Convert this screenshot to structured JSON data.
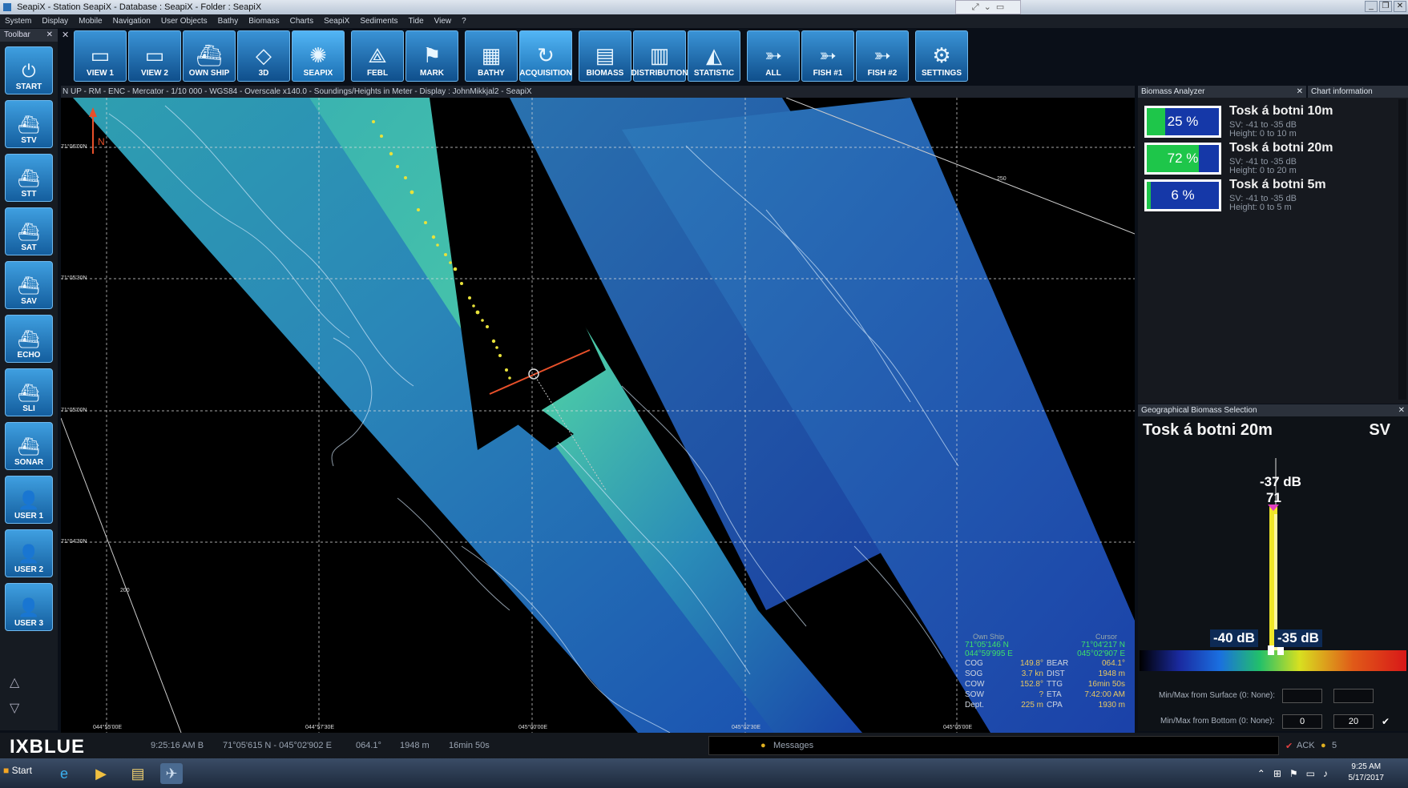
{
  "window": {
    "title": "SeapiX - Station SeapiX - Database : SeapiX - Folder : SeapiX"
  },
  "menu": [
    "System",
    "Display",
    "Mobile",
    "Navigation",
    "User Objects",
    "Bathy",
    "Biomass",
    "Charts",
    "SeapiX",
    "Sediments",
    "Tide",
    "View",
    "?"
  ],
  "toolbar_label": "Toolbar",
  "left_tools": [
    {
      "label": "START",
      "icon": "power-icon"
    },
    {
      "label": "STV",
      "icon": "ship-icon"
    },
    {
      "label": "STT",
      "icon": "ship-icon"
    },
    {
      "label": "SAT",
      "icon": "ship-icon"
    },
    {
      "label": "SAV",
      "icon": "ship-icon"
    },
    {
      "label": "ECHO",
      "icon": "ship-icon"
    },
    {
      "label": "SLI",
      "icon": "ship-icon"
    },
    {
      "label": "SONAR",
      "icon": "ship-icon"
    },
    {
      "label": "USER 1",
      "icon": "user-icon"
    },
    {
      "label": "USER 2",
      "icon": "user-icon"
    },
    {
      "label": "USER 3",
      "icon": "user-icon"
    }
  ],
  "top_tools": [
    {
      "label": "VIEW 1",
      "icon": "monitor-icon"
    },
    {
      "label": "VIEW 2",
      "icon": "monitor-icon"
    },
    {
      "label": "OWN SHIP",
      "icon": "ship-icon"
    },
    {
      "label": "3D",
      "icon": "3d-icon"
    },
    {
      "label": "SEAPIX",
      "icon": "seapix-icon"
    },
    {
      "label": "FEBL",
      "icon": "compass-icon"
    },
    {
      "label": "MARK",
      "icon": "flag-icon"
    },
    {
      "label": "BATHY",
      "icon": "bathy-icon"
    },
    {
      "label": "ACQUISITION",
      "icon": "refresh-icon"
    },
    {
      "label": "BIOMASS",
      "icon": "biomass-icon"
    },
    {
      "label": "DISTRIBUTION",
      "icon": "distribution-icon"
    },
    {
      "label": "STATISTIC",
      "icon": "statistic-icon"
    },
    {
      "label": "ALL",
      "icon": "fish-icon"
    },
    {
      "label": "FISH #1",
      "icon": "fish-icon"
    },
    {
      "label": "FISH #2",
      "icon": "fish-icon"
    },
    {
      "label": "SETTINGS",
      "icon": "gear-icon"
    }
  ],
  "chart_bar": "N UP  -  RM  -  ENC  -  Mercator  -  1/10 000  -  WGS84  -  Overscale x140.0  -  Soundings/Heights in Meter  -  Display : JohnMikkjal2  -  SeapiX",
  "map": {
    "lat_labels": [
      "71°06'00N",
      "71°05'30N",
      "71°05'00N",
      "71°04'30N"
    ],
    "lon_labels": [
      "044°55'00E",
      "044°57'30E",
      "045°00'00E",
      "045°02'30E",
      "045°05'00E"
    ],
    "depth_labels": [
      "250",
      "200"
    ],
    "north": "N"
  },
  "ship_info": {
    "own_ship_label": "Own Ship",
    "cursor_label": "Cursor",
    "own_lat": "71°05'146 N",
    "own_lon": "044°59'995 E",
    "cursor_lat": "71°04'217 N",
    "cursor_lon": "045°02'907 E",
    "rows": [
      {
        "k1": "COG",
        "v1": "149.8°",
        "k2": "BEAR",
        "v2": "064.1°"
      },
      {
        "k1": "SOG",
        "v1": "3.7 kn",
        "k2": "DIST",
        "v2": "1948 m"
      },
      {
        "k1": "COW",
        "v1": "152.8°",
        "k2": "TTG",
        "v2": "16min 50s"
      },
      {
        "k1": "SOW",
        "v1": "?",
        "k2": "ETA",
        "v2": "7:42:00 AM"
      },
      {
        "k1": "Dept.",
        "v1": "225 m",
        "k2": "CPA",
        "v2": "1930 m"
      }
    ]
  },
  "biomass_panel": {
    "title": "Biomass Analyzer",
    "chart_info_tab": "Chart information",
    "items": [
      {
        "percent": "25 %",
        "fraction": 0.25,
        "name": "Tosk á botni 10m",
        "sv": "SV: -41 to -35 dB",
        "height": "Height: 0 to 10 m"
      },
      {
        "percent": "72 %",
        "fraction": 0.72,
        "name": "Tosk á botni 20m",
        "sv": "SV: -41 to -35 dB",
        "height": "Height: 0 to 20 m"
      },
      {
        "percent": "6 %",
        "fraction": 0.06,
        "name": "Tosk á botni 5m",
        "sv": "SV: -41 to -35 dB",
        "height": "Height: 0 to 5 m"
      }
    ]
  },
  "geo_panel": {
    "title": "Geographical Biomass Selection",
    "selection": "Tosk á botni 20m",
    "mode": "SV",
    "peak_db": "-37 dB",
    "peak_value": "71",
    "min_db": "-40 dB",
    "max_db": "-35 dB",
    "surface_label": "Min/Max from Surface (0: None):",
    "bottom_label": "Min/Max from Bottom (0: None):",
    "bottom_min": "0",
    "bottom_max": "20"
  },
  "status": {
    "brand": "IXBLUE",
    "time": "9:25:16 AM B",
    "position": "71°05'615 N - 045°02'902 E",
    "bearing": "064.1°",
    "distance": "1948 m",
    "ttg": "16min 50s",
    "message": "Messages",
    "ack": "ACK",
    "alerts": "5"
  },
  "taskbar": {
    "start": "Start",
    "clock_time": "9:25 AM",
    "clock_date": "5/17/2017"
  }
}
